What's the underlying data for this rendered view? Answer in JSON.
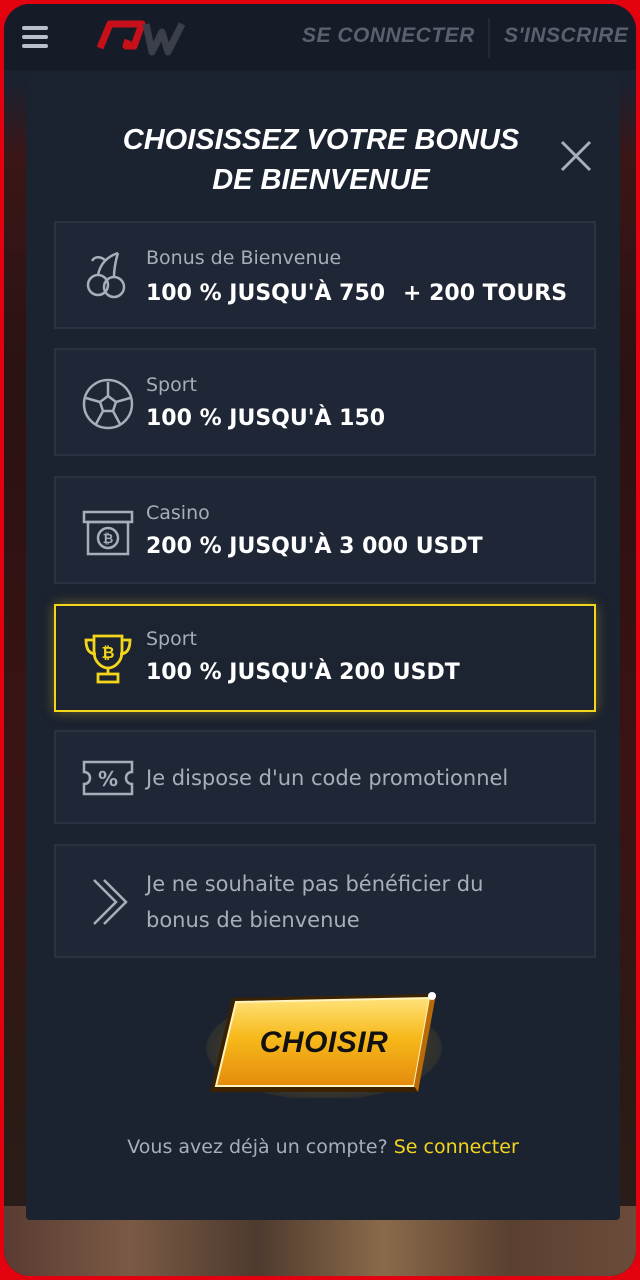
{
  "header": {
    "logo_text": "QW",
    "login_label": "SE CONNECTER",
    "signup_label": "S'INSCRIRE"
  },
  "modal": {
    "title_line1": "CHOISISSEZ VOTRE BONUS",
    "title_line2": "DE BIENVENUE",
    "options": [
      {
        "icon": "cherries-icon",
        "subtitle": "Bonus de Bienvenue",
        "main": "100 % JUSQU'À 750",
        "extra": "+ 200 TOURS",
        "selected": false
      },
      {
        "icon": "soccer-ball-icon",
        "subtitle": "Sport",
        "main": "100 % JUSQU'À 150",
        "selected": false
      },
      {
        "icon": "bitcoin-chest-icon",
        "subtitle": "Casino",
        "main": "200 % JUSQU'À 3 000 USDT",
        "selected": false
      },
      {
        "icon": "bitcoin-trophy-icon",
        "subtitle": "Sport",
        "main": "100 % JUSQU'À 200 USDT",
        "selected": true
      },
      {
        "icon": "promo-ticket-icon",
        "text": "Je dispose d'un code promotionnel",
        "selected": false
      },
      {
        "icon": "chevron-right-icon",
        "text_line1": "Je ne souhaite pas bénéficier du",
        "text_line2": "bonus de bienvenue",
        "selected": false
      }
    ],
    "cta_label": "CHOISIR",
    "login_prompt": "Vous avez déjà un compte?",
    "login_link": "Se connecter"
  },
  "colors": {
    "accent_yellow": "#f3d51c",
    "modal_bg": "#1b2230",
    "option_bg": "#1f2635",
    "frame_red": "#e3000f"
  }
}
